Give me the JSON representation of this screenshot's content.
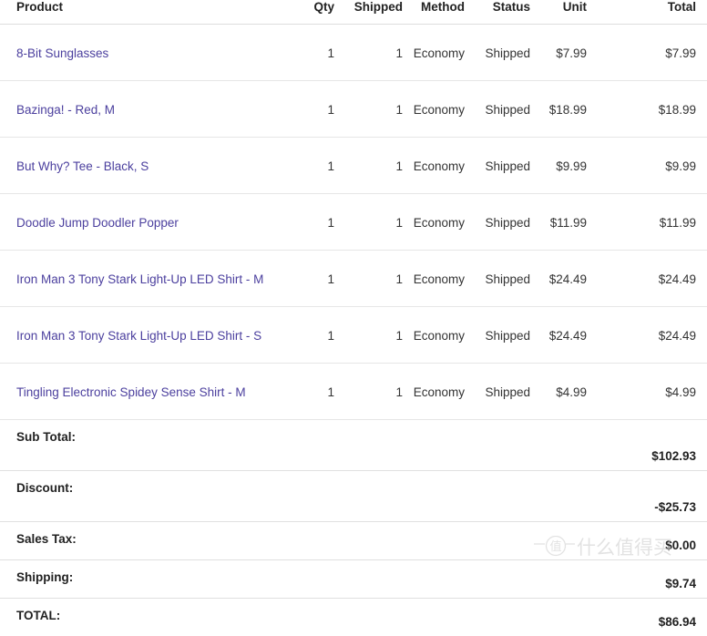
{
  "table": {
    "columns": [
      {
        "key": "product",
        "label": "Product",
        "align": "left"
      },
      {
        "key": "qty",
        "label": "Qty",
        "align": "right"
      },
      {
        "key": "shipped",
        "label": "Shipped",
        "align": "right"
      },
      {
        "key": "method",
        "label": "Method",
        "align": "right"
      },
      {
        "key": "status",
        "label": "Status",
        "align": "right"
      },
      {
        "key": "unit",
        "label": "Unit",
        "align": "right"
      },
      {
        "key": "total",
        "label": "Total",
        "align": "right"
      }
    ],
    "rows": [
      {
        "product": "8-Bit Sunglasses",
        "qty": "1",
        "shipped": "1",
        "method": "Economy",
        "status": "Shipped",
        "unit": "$7.99",
        "total": "$7.99"
      },
      {
        "product": "Bazinga! - Red, M",
        "qty": "1",
        "shipped": "1",
        "method": "Economy",
        "status": "Shipped",
        "unit": "$18.99",
        "total": "$18.99"
      },
      {
        "product": "But Why? Tee - Black, S",
        "qty": "1",
        "shipped": "1",
        "method": "Economy",
        "status": "Shipped",
        "unit": "$9.99",
        "total": "$9.99"
      },
      {
        "product": "Doodle Jump Doodler Popper",
        "qty": "1",
        "shipped": "1",
        "method": "Economy",
        "status": "Shipped",
        "unit": "$11.99",
        "total": "$11.99"
      },
      {
        "product": "Iron Man 3 Tony Stark Light-Up LED Shirt - M",
        "qty": "1",
        "shipped": "1",
        "method": "Economy",
        "status": "Shipped",
        "unit": "$24.49",
        "total": "$24.49"
      },
      {
        "product": "Iron Man 3 Tony Stark Light-Up LED Shirt - S",
        "qty": "1",
        "shipped": "1",
        "method": "Economy",
        "status": "Shipped",
        "unit": "$24.49",
        "total": "$24.49"
      },
      {
        "product": "Tingling Electronic Spidey Sense Shirt - M",
        "qty": "1",
        "shipped": "1",
        "method": "Economy",
        "status": "Shipped",
        "unit": "$4.99",
        "total": "$4.99"
      }
    ],
    "summary": [
      {
        "label": "Sub Total:",
        "value": "$102.93"
      },
      {
        "label": "Discount:",
        "value": "-$25.73"
      },
      {
        "label": "Sales Tax:",
        "value": "$0.00"
      },
      {
        "label": "Shipping:",
        "value": "$9.74"
      },
      {
        "label": "TOTAL:",
        "value": "$86.94"
      }
    ]
  },
  "watermark": {
    "logo_char": "值",
    "text": "什么值得买"
  },
  "colors": {
    "link": "#4b3f9e",
    "text": "#333333",
    "heading": "#222222",
    "rule": "#e6e6e6",
    "head_rule": "#dddddd",
    "background": "#ffffff"
  }
}
